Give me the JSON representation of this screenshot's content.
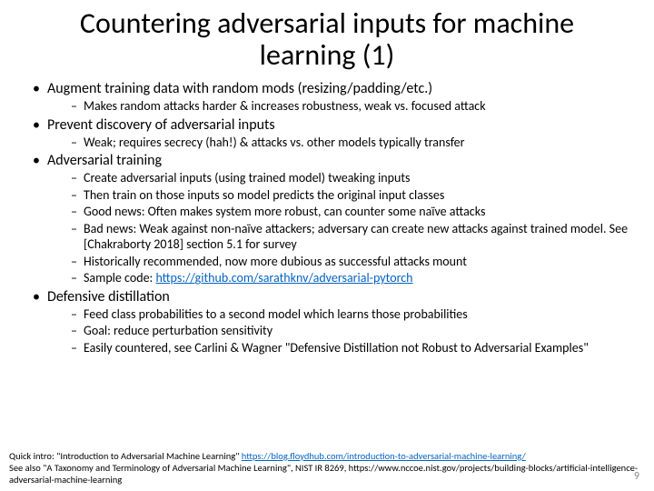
{
  "title": "Countering adversarial inputs for machine learning (1)",
  "bullets": [
    {
      "text": "Augment training data with random mods (resizing/padding/etc.)",
      "sub": [
        "Makes random attacks harder & increases robustness, weak vs. focused attack"
      ]
    },
    {
      "text": "Prevent discovery of adversarial inputs",
      "sub": [
        "Weak; requires secrecy (hah!) & attacks vs. other models typically transfer"
      ]
    },
    {
      "text": "Adversarial training",
      "sub": [
        "Create adversarial inputs (using trained model) tweaking inputs",
        "Then train on those inputs so model predicts the original input classes",
        "Good news:  Often makes system more robust, can counter some naïve attacks",
        "Bad news: Weak against non-naïve attackers; adversary can create new attacks against trained model. See [Chakraborty 2018] section 5.1 for survey",
        "Historically recommended, now more dubious as successful attacks mount",
        "Sample code: https://github.com/sarathknv/adversarial-pytorch"
      ]
    },
    {
      "text": "Defensive distillation",
      "sub": [
        "Feed class probabilities to a second model which learns those probabilities",
        "Goal: reduce perturbation sensitivity",
        "Easily countered, see Carlini & Wagner \"Defensive Distillation not Robust to Adversarial Examples\""
      ]
    }
  ],
  "sample_code_prefix": "Sample code: ",
  "sample_code_link": "https://github.com/sarathknv/adversarial-pytorch",
  "footer": {
    "line1a": "Quick intro: \"Introduction to Adversarial Machine Learning\" ",
    "line1b": "https://blog.floydhub.com/introduction-to-adversarial-machine-learning/",
    "line2": "See also \"A Taxonomy and Terminology of Adversarial Machine Learning\", NIST IR 8269, https://www.nccoe.nist.gov/projects/building-blocks/artificial-intelligence-adversarial-machine-learning"
  },
  "page_number": "9"
}
